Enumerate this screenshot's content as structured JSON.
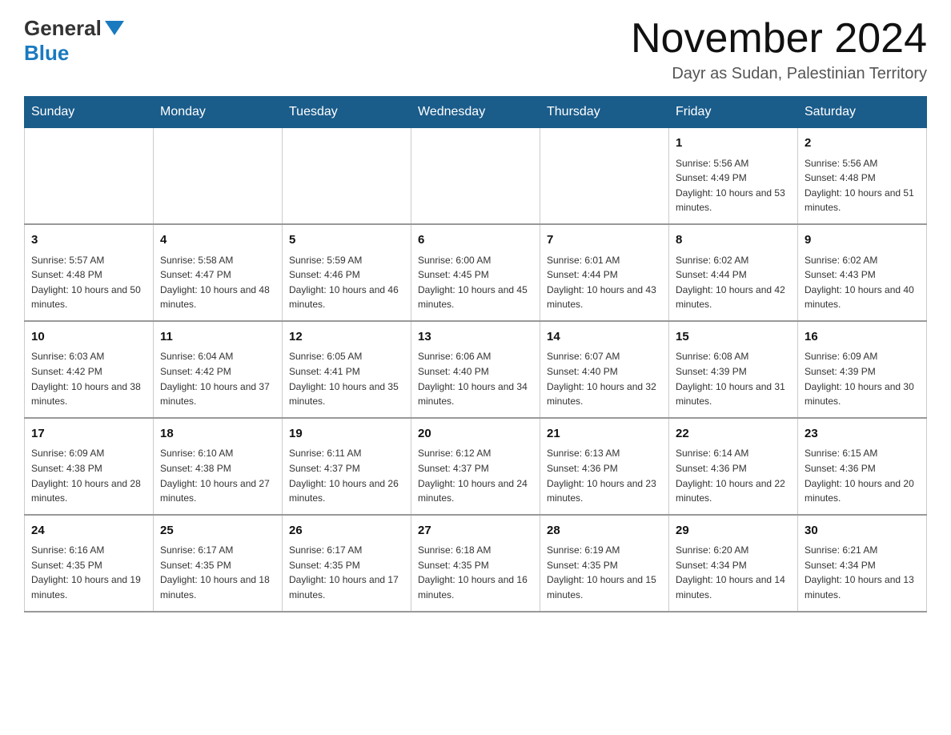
{
  "logo": {
    "general": "General",
    "blue": "Blue"
  },
  "header": {
    "month_year": "November 2024",
    "location": "Dayr as Sudan, Palestinian Territory"
  },
  "weekdays": [
    "Sunday",
    "Monday",
    "Tuesday",
    "Wednesday",
    "Thursday",
    "Friday",
    "Saturday"
  ],
  "weeks": [
    [
      {
        "day": "",
        "sunrise": "",
        "sunset": "",
        "daylight": ""
      },
      {
        "day": "",
        "sunrise": "",
        "sunset": "",
        "daylight": ""
      },
      {
        "day": "",
        "sunrise": "",
        "sunset": "",
        "daylight": ""
      },
      {
        "day": "",
        "sunrise": "",
        "sunset": "",
        "daylight": ""
      },
      {
        "day": "",
        "sunrise": "",
        "sunset": "",
        "daylight": ""
      },
      {
        "day": "1",
        "sunrise": "Sunrise: 5:56 AM",
        "sunset": "Sunset: 4:49 PM",
        "daylight": "Daylight: 10 hours and 53 minutes."
      },
      {
        "day": "2",
        "sunrise": "Sunrise: 5:56 AM",
        "sunset": "Sunset: 4:48 PM",
        "daylight": "Daylight: 10 hours and 51 minutes."
      }
    ],
    [
      {
        "day": "3",
        "sunrise": "Sunrise: 5:57 AM",
        "sunset": "Sunset: 4:48 PM",
        "daylight": "Daylight: 10 hours and 50 minutes."
      },
      {
        "day": "4",
        "sunrise": "Sunrise: 5:58 AM",
        "sunset": "Sunset: 4:47 PM",
        "daylight": "Daylight: 10 hours and 48 minutes."
      },
      {
        "day": "5",
        "sunrise": "Sunrise: 5:59 AM",
        "sunset": "Sunset: 4:46 PM",
        "daylight": "Daylight: 10 hours and 46 minutes."
      },
      {
        "day": "6",
        "sunrise": "Sunrise: 6:00 AM",
        "sunset": "Sunset: 4:45 PM",
        "daylight": "Daylight: 10 hours and 45 minutes."
      },
      {
        "day": "7",
        "sunrise": "Sunrise: 6:01 AM",
        "sunset": "Sunset: 4:44 PM",
        "daylight": "Daylight: 10 hours and 43 minutes."
      },
      {
        "day": "8",
        "sunrise": "Sunrise: 6:02 AM",
        "sunset": "Sunset: 4:44 PM",
        "daylight": "Daylight: 10 hours and 42 minutes."
      },
      {
        "day": "9",
        "sunrise": "Sunrise: 6:02 AM",
        "sunset": "Sunset: 4:43 PM",
        "daylight": "Daylight: 10 hours and 40 minutes."
      }
    ],
    [
      {
        "day": "10",
        "sunrise": "Sunrise: 6:03 AM",
        "sunset": "Sunset: 4:42 PM",
        "daylight": "Daylight: 10 hours and 38 minutes."
      },
      {
        "day": "11",
        "sunrise": "Sunrise: 6:04 AM",
        "sunset": "Sunset: 4:42 PM",
        "daylight": "Daylight: 10 hours and 37 minutes."
      },
      {
        "day": "12",
        "sunrise": "Sunrise: 6:05 AM",
        "sunset": "Sunset: 4:41 PM",
        "daylight": "Daylight: 10 hours and 35 minutes."
      },
      {
        "day": "13",
        "sunrise": "Sunrise: 6:06 AM",
        "sunset": "Sunset: 4:40 PM",
        "daylight": "Daylight: 10 hours and 34 minutes."
      },
      {
        "day": "14",
        "sunrise": "Sunrise: 6:07 AM",
        "sunset": "Sunset: 4:40 PM",
        "daylight": "Daylight: 10 hours and 32 minutes."
      },
      {
        "day": "15",
        "sunrise": "Sunrise: 6:08 AM",
        "sunset": "Sunset: 4:39 PM",
        "daylight": "Daylight: 10 hours and 31 minutes."
      },
      {
        "day": "16",
        "sunrise": "Sunrise: 6:09 AM",
        "sunset": "Sunset: 4:39 PM",
        "daylight": "Daylight: 10 hours and 30 minutes."
      }
    ],
    [
      {
        "day": "17",
        "sunrise": "Sunrise: 6:09 AM",
        "sunset": "Sunset: 4:38 PM",
        "daylight": "Daylight: 10 hours and 28 minutes."
      },
      {
        "day": "18",
        "sunrise": "Sunrise: 6:10 AM",
        "sunset": "Sunset: 4:38 PM",
        "daylight": "Daylight: 10 hours and 27 minutes."
      },
      {
        "day": "19",
        "sunrise": "Sunrise: 6:11 AM",
        "sunset": "Sunset: 4:37 PM",
        "daylight": "Daylight: 10 hours and 26 minutes."
      },
      {
        "day": "20",
        "sunrise": "Sunrise: 6:12 AM",
        "sunset": "Sunset: 4:37 PM",
        "daylight": "Daylight: 10 hours and 24 minutes."
      },
      {
        "day": "21",
        "sunrise": "Sunrise: 6:13 AM",
        "sunset": "Sunset: 4:36 PM",
        "daylight": "Daylight: 10 hours and 23 minutes."
      },
      {
        "day": "22",
        "sunrise": "Sunrise: 6:14 AM",
        "sunset": "Sunset: 4:36 PM",
        "daylight": "Daylight: 10 hours and 22 minutes."
      },
      {
        "day": "23",
        "sunrise": "Sunrise: 6:15 AM",
        "sunset": "Sunset: 4:36 PM",
        "daylight": "Daylight: 10 hours and 20 minutes."
      }
    ],
    [
      {
        "day": "24",
        "sunrise": "Sunrise: 6:16 AM",
        "sunset": "Sunset: 4:35 PM",
        "daylight": "Daylight: 10 hours and 19 minutes."
      },
      {
        "day": "25",
        "sunrise": "Sunrise: 6:17 AM",
        "sunset": "Sunset: 4:35 PM",
        "daylight": "Daylight: 10 hours and 18 minutes."
      },
      {
        "day": "26",
        "sunrise": "Sunrise: 6:17 AM",
        "sunset": "Sunset: 4:35 PM",
        "daylight": "Daylight: 10 hours and 17 minutes."
      },
      {
        "day": "27",
        "sunrise": "Sunrise: 6:18 AM",
        "sunset": "Sunset: 4:35 PM",
        "daylight": "Daylight: 10 hours and 16 minutes."
      },
      {
        "day": "28",
        "sunrise": "Sunrise: 6:19 AM",
        "sunset": "Sunset: 4:35 PM",
        "daylight": "Daylight: 10 hours and 15 minutes."
      },
      {
        "day": "29",
        "sunrise": "Sunrise: 6:20 AM",
        "sunset": "Sunset: 4:34 PM",
        "daylight": "Daylight: 10 hours and 14 minutes."
      },
      {
        "day": "30",
        "sunrise": "Sunrise: 6:21 AM",
        "sunset": "Sunset: 4:34 PM",
        "daylight": "Daylight: 10 hours and 13 minutes."
      }
    ]
  ]
}
